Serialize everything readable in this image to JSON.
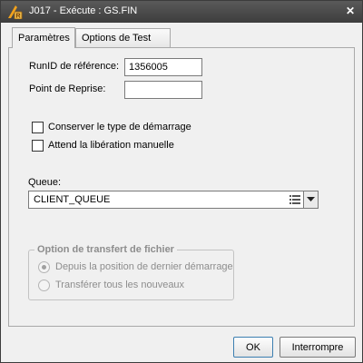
{
  "window": {
    "title": "J017 - Exécute : GS.FIN",
    "close_icon": "close-icon"
  },
  "tabs": [
    {
      "label": "Paramètres",
      "active": true
    },
    {
      "label": "Options de Test",
      "active": false
    }
  ],
  "form": {
    "runid_label": "RunID de référence:",
    "runid_value": "1356005",
    "restart_label": "Point de Reprise:",
    "restart_value": "",
    "keep_start_type_label": "Conserver le type de démarrage",
    "keep_start_type_checked": false,
    "manual_release_label": "Attend la libération manuelle",
    "manual_release_checked": false,
    "queue_label": "Queue:",
    "queue_value": "CLIENT_QUEUE"
  },
  "transfer": {
    "legend": "Option de transfert de fichier",
    "options": [
      {
        "label": "Depuis la position de dernier démarrage",
        "selected": true
      },
      {
        "label": "Transférer tous les nouveaux",
        "selected": false
      }
    ]
  },
  "buttons": {
    "ok": "OK",
    "interrupt": "Interrompre"
  }
}
